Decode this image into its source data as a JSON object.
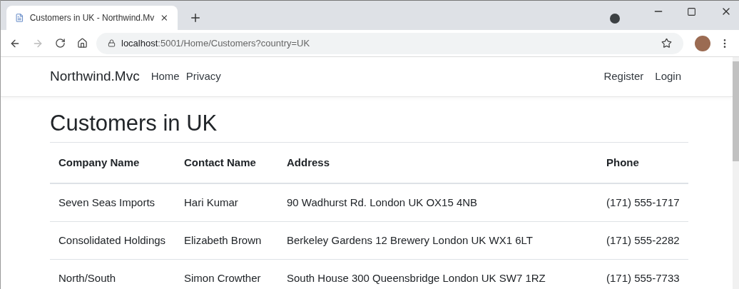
{
  "browser": {
    "tab_title": "Customers in UK - Northwind.Mv",
    "url_host": "localhost",
    "url_rest": ":5001/Home/Customers?country=UK"
  },
  "navbar": {
    "brand": "Northwind.Mvc",
    "links": [
      "Home",
      "Privacy"
    ],
    "account_links": [
      "Register",
      "Login"
    ]
  },
  "heading": "Customers in UK",
  "table": {
    "columns": [
      "Company Name",
      "Contact Name",
      "Address",
      "Phone"
    ],
    "rows": [
      [
        "Seven Seas Imports",
        "Hari Kumar",
        "90 Wadhurst Rd. London UK OX15 4NB",
        "(171) 555-1717"
      ],
      [
        "Consolidated Holdings",
        "Elizabeth Brown",
        "Berkeley Gardens 12 Brewery London UK WX1 6LT",
        "(171) 555-2282"
      ],
      [
        "North/South",
        "Simon Crowther",
        "South House 300 Queensbridge London UK SW7 1RZ",
        "(171) 555-7733"
      ]
    ]
  }
}
